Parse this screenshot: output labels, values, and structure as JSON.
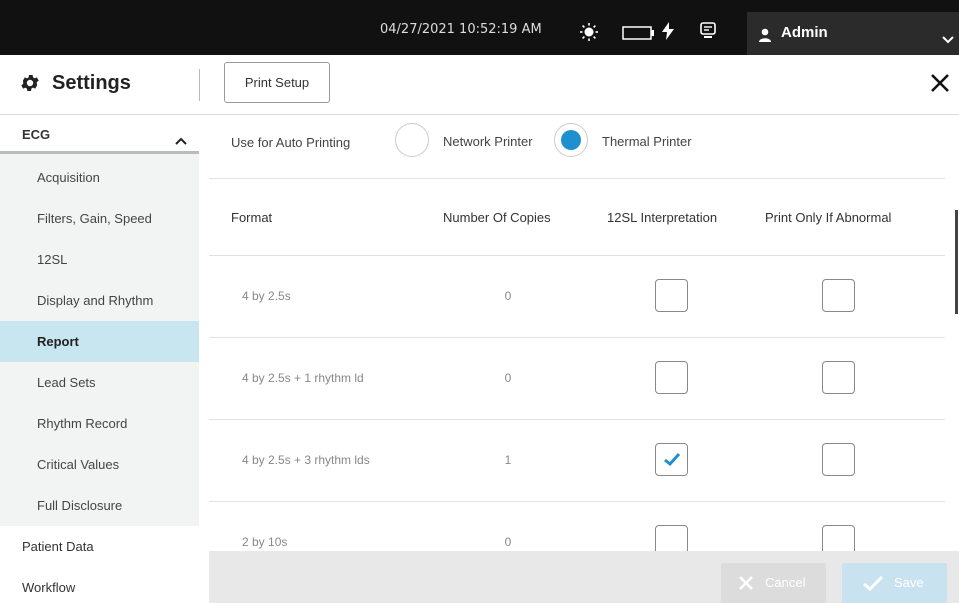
{
  "topbar": {
    "datetime": "04/27/2021 10:52:19 AM",
    "icons": [
      "sun-icon",
      "battery-icon",
      "charging-bolt-icon",
      "monitor-icon"
    ],
    "user": {
      "icon": "user-icon",
      "name": "Admin",
      "menu_icon": "chevron-down-icon"
    }
  },
  "header": {
    "icon": "gear-icon",
    "title": "Settings",
    "print_setup_label": "Print Setup",
    "close_icon": "close-icon"
  },
  "sidebar": {
    "section": {
      "label": "ECG",
      "icon": "chevron-up-icon"
    },
    "items": [
      {
        "label": "Acquisition",
        "active": false
      },
      {
        "label": "Filters, Gain, Speed",
        "active": false
      },
      {
        "label": "12SL",
        "active": false
      },
      {
        "label": "Display and Rhythm",
        "active": false
      },
      {
        "label": "Report",
        "active": true
      },
      {
        "label": "Lead Sets",
        "active": false
      },
      {
        "label": "Rhythm Record",
        "active": false
      },
      {
        "label": "Critical Values",
        "active": false
      },
      {
        "label": "Full Disclosure",
        "active": false
      }
    ],
    "top_items": [
      {
        "label": "Patient Data"
      },
      {
        "label": "Workflow"
      }
    ]
  },
  "auto_printing": {
    "label": "Use for Auto Printing",
    "options": [
      {
        "label": "Network Printer",
        "selected": false
      },
      {
        "label": "Thermal Printer",
        "selected": true
      }
    ]
  },
  "table": {
    "headers": [
      "Format",
      "Number Of Copies",
      "12SL Interpretation",
      "Print Only If Abnormal"
    ],
    "rows": [
      {
        "format": "4 by 2.5s",
        "copies": "0",
        "interpretation": false,
        "abnormal_only": false
      },
      {
        "format": "4 by 2.5s + 1 rhythm ld",
        "copies": "0",
        "interpretation": false,
        "abnormal_only": false
      },
      {
        "format": "4 by 2.5s + 3 rhythm lds",
        "copies": "1",
        "interpretation": true,
        "abnormal_only": false
      },
      {
        "format": "2 by 10s",
        "copies": "0",
        "interpretation": false,
        "abnormal_only": false
      }
    ]
  },
  "footer": {
    "cancel_label": "Cancel",
    "save_label": "Save"
  },
  "colors": {
    "topbar": "#111111",
    "accent": "#1e90d0",
    "active_sidebar": "#c7e6f0"
  }
}
